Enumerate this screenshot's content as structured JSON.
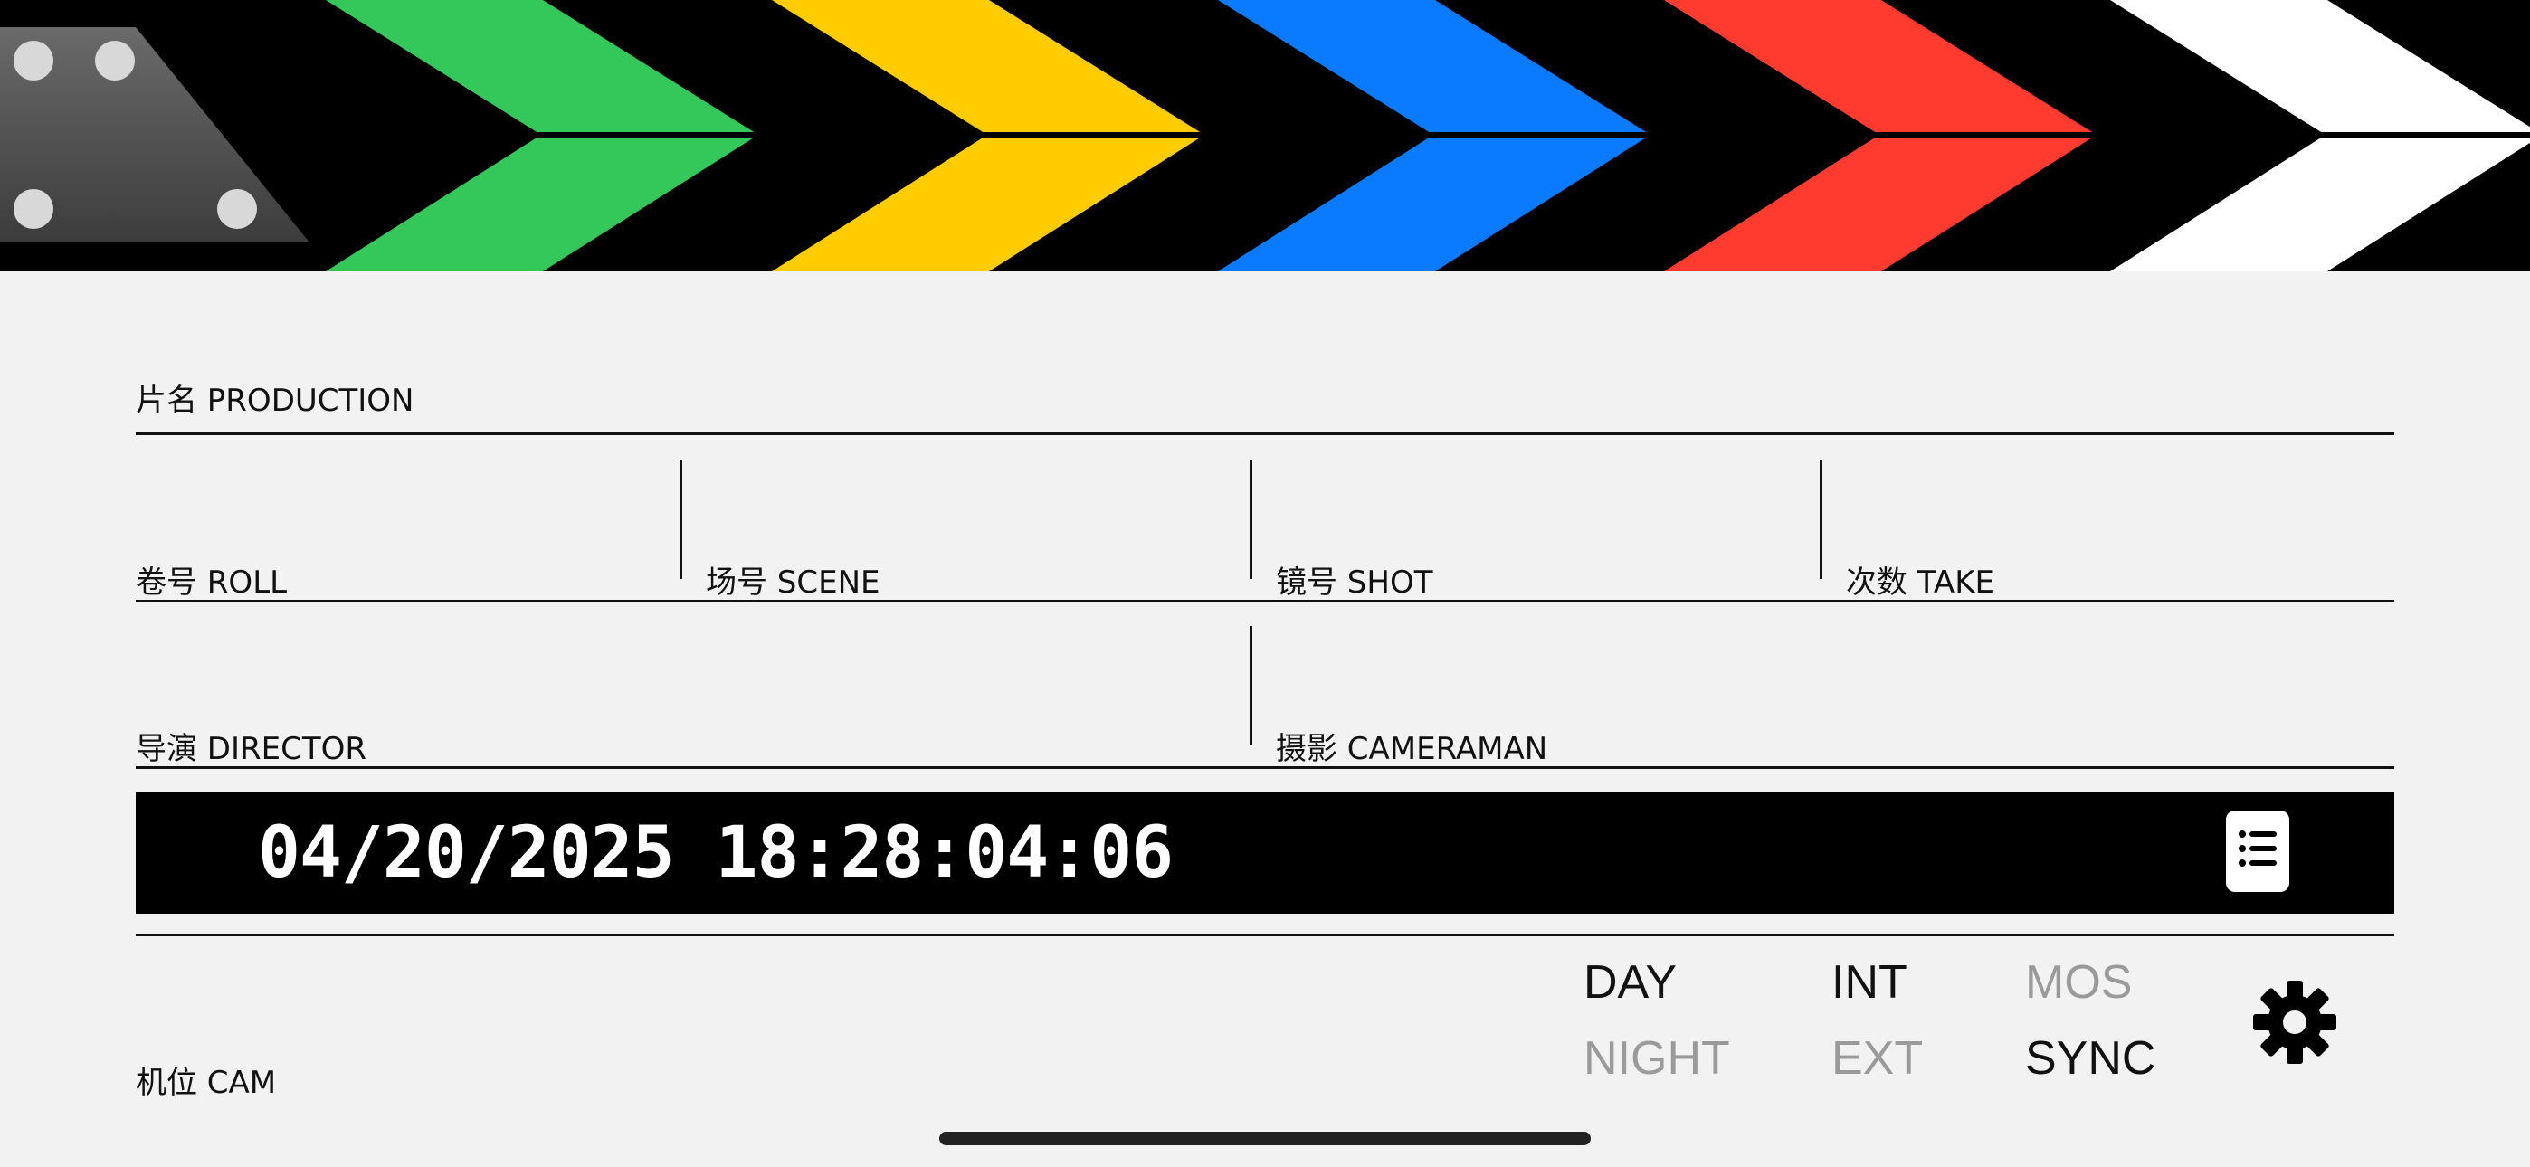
{
  "clapper": {
    "stripe_colors": [
      "#34c759",
      "#ffcc00",
      "#0a7aff",
      "#ff3b30",
      "#ffffff"
    ],
    "hinge_color": "#4a4a4a"
  },
  "fields": {
    "production": "片名 PRODUCTION",
    "roll": "卷号 ROLL",
    "scene": "场号 SCENE",
    "shot": "镜号 SHOT",
    "take": "次数 TAKE",
    "director": "导演 DIRECTOR",
    "cameraman": "摄影 CAMERAMAN",
    "cam": "机位 CAM"
  },
  "timecode": {
    "value": "04/20/2025 18:28:04:06"
  },
  "toggles": {
    "day": "DAY",
    "night": "NIGHT",
    "int": "INT",
    "ext": "EXT",
    "mos": "MOS",
    "sync": "SYNC",
    "active": [
      "DAY",
      "INT",
      "SYNC"
    ]
  },
  "icons": {
    "list": "list-icon",
    "settings": "gear-icon"
  }
}
